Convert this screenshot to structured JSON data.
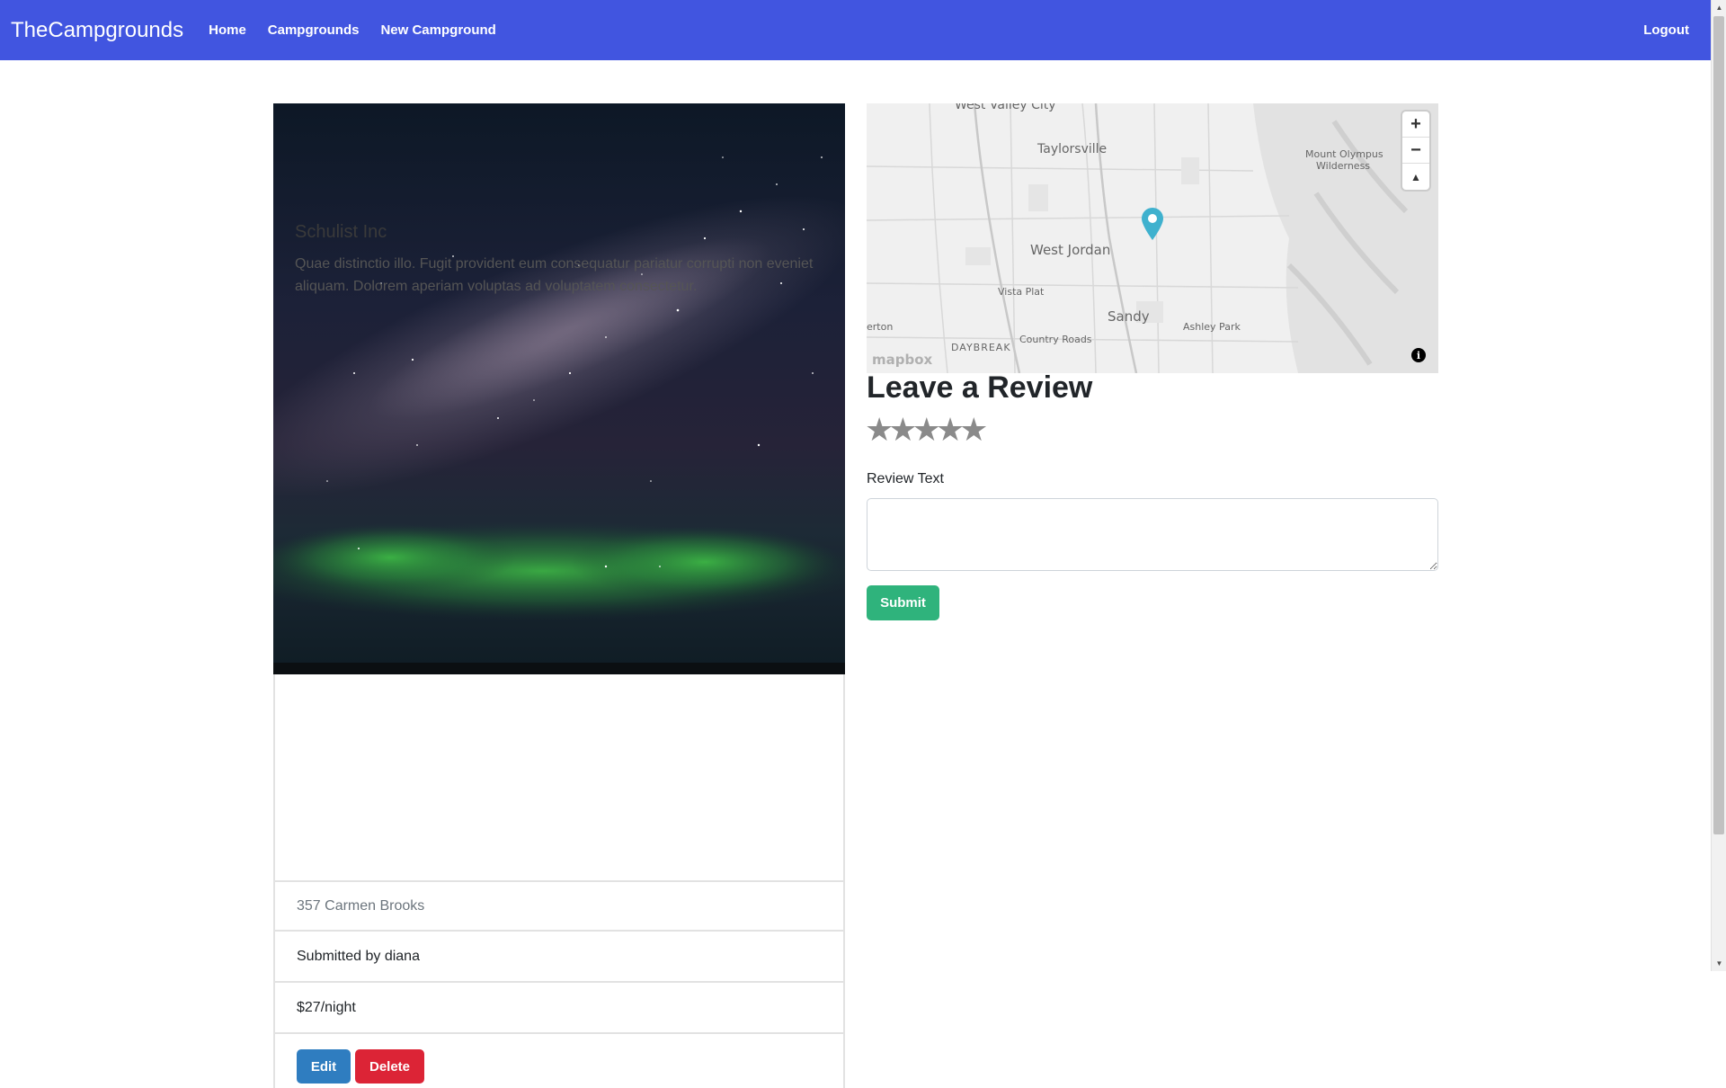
{
  "navbar": {
    "brand": "TheCampgrounds",
    "links": [
      "Home",
      "Campgrounds",
      "New Campground"
    ],
    "logout": "Logout",
    "color": "#4155e0"
  },
  "campground": {
    "title": "Schulist Inc",
    "description": "Quae distinctio illo. Fugit provident eum consequatur pariatur corrupti non eveniet aliquam. Dolorem aperiam voluptas ad voluptatem consectetur.",
    "location": "357 Carmen Brooks",
    "author": "Submitted by diana",
    "price": "$27/night",
    "edit_label": "Edit",
    "delete_label": "Delete"
  },
  "map": {
    "labels": {
      "west_valley": "West Valley City",
      "taylorsville": "Taylorsville",
      "mount_olympus": "Mount Olympus",
      "wilderness": "Wilderness",
      "west_jordan": "West Jordan",
      "vista_plat": "Vista Plat",
      "sandy": "Sandy",
      "ashley_park": "Ashley Park",
      "herriman": "erton",
      "daybreak": "DAYBREAK",
      "country_roads": "Country Roads"
    },
    "attribution": "mapbox",
    "zoom_in": "+",
    "zoom_out": "−",
    "compass": "▲",
    "info": "i"
  },
  "review": {
    "title": "Leave a Review",
    "rating_stars": [
      "★",
      "★",
      "★",
      "★",
      "★"
    ],
    "text_label": "Review Text",
    "text_value": "",
    "submit_label": "Submit"
  }
}
